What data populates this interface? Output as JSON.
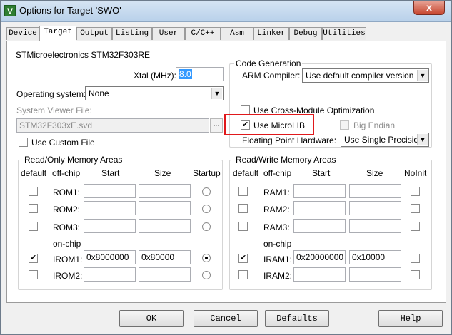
{
  "window": {
    "title": "Options for Target 'SWO'",
    "close_glyph": "x",
    "app_icon_glyph": "V"
  },
  "tabs": [
    "Device",
    "Target",
    "Output",
    "Listing",
    "User",
    "C/C++",
    "Asm",
    "Linker",
    "Debug",
    "Utilities"
  ],
  "target": {
    "device": "STMicroelectronics STM32F303RE",
    "xtal_label": "Xtal (MHz):",
    "xtal_value": "8.0",
    "os_label": "Operating system:",
    "os_value": "None",
    "svd_label": "System Viewer File:",
    "svd_value": "STM32F303xE.svd",
    "svd_browse": "...",
    "custom_file_label": "Use Custom File"
  },
  "codegen": {
    "caption": "Code Generation",
    "compiler_label": "ARM Compiler:",
    "compiler_value": "Use default compiler version",
    "cross_module_label": "Use Cross-Module Optimization",
    "microlib_label": "Use MicroLIB",
    "microlib_checked": true,
    "big_endian_label": "Big Endian",
    "fpu_label": "Floating Point Hardware:",
    "fpu_value": "Use Single Precision"
  },
  "rom": {
    "caption": "Read/Only Memory Areas",
    "headers": {
      "default": "default",
      "offchip": "off-chip",
      "start": "Start",
      "size": "Size",
      "startup": "Startup"
    },
    "onchip_label": "on-chip",
    "rows": [
      {
        "label": "ROM1:",
        "start": "",
        "size": "",
        "default": false,
        "startup": false
      },
      {
        "label": "ROM2:",
        "start": "",
        "size": "",
        "default": false,
        "startup": false
      },
      {
        "label": "ROM3:",
        "start": "",
        "size": "",
        "default": false,
        "startup": false
      },
      {
        "label": "IROM1:",
        "start": "0x8000000",
        "size": "0x80000",
        "default": true,
        "startup": true
      },
      {
        "label": "IROM2:",
        "start": "",
        "size": "",
        "default": false,
        "startup": false
      }
    ]
  },
  "ram": {
    "caption": "Read/Write Memory Areas",
    "headers": {
      "default": "default",
      "offchip": "off-chip",
      "start": "Start",
      "size": "Size",
      "noinit": "NoInit"
    },
    "onchip_label": "on-chip",
    "rows": [
      {
        "label": "RAM1:",
        "start": "",
        "size": "",
        "default": false,
        "noinit": false
      },
      {
        "label": "RAM2:",
        "start": "",
        "size": "",
        "default": false,
        "noinit": false
      },
      {
        "label": "RAM3:",
        "start": "",
        "size": "",
        "default": false,
        "noinit": false
      },
      {
        "label": "IRAM1:",
        "start": "0x20000000",
        "size": "0x10000",
        "default": true,
        "noinit": false
      },
      {
        "label": "IRAM2:",
        "start": "",
        "size": "",
        "default": false,
        "noinit": false
      }
    ]
  },
  "buttons": {
    "ok": "OK",
    "cancel": "Cancel",
    "defaults": "Defaults",
    "help": "Help"
  },
  "colors": {
    "highlight": "#e0181b",
    "selection": "#3399ff"
  }
}
